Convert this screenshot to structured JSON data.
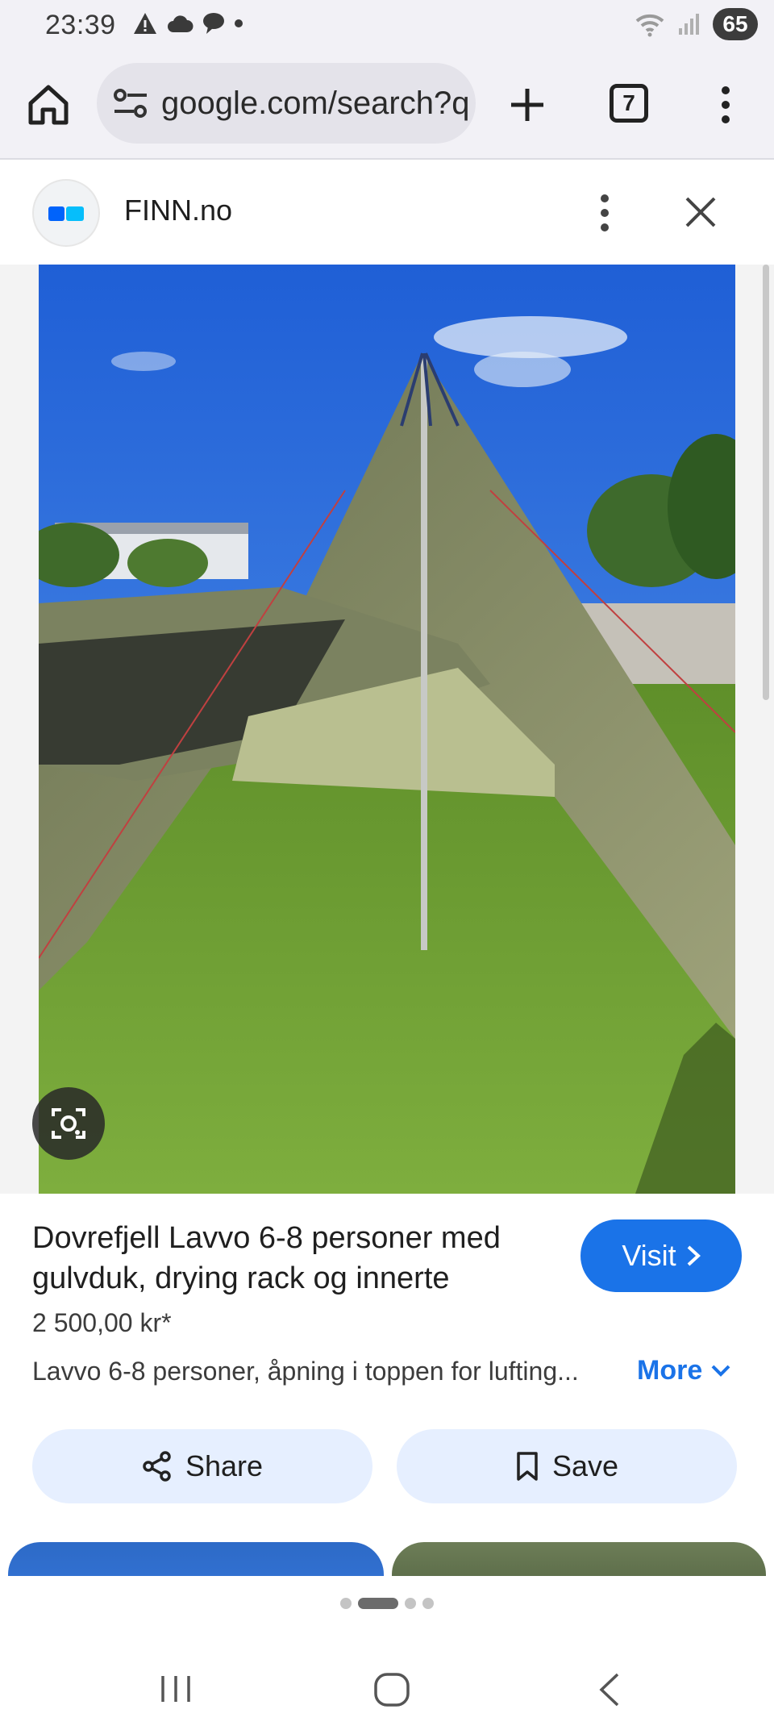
{
  "status_bar": {
    "time": "23:39",
    "battery": "65",
    "left_icons": [
      "warning-icon",
      "cloud-icon",
      "chat-icon",
      "dot-icon"
    ],
    "right_icons": [
      "wifi-icon",
      "signal-icon"
    ]
  },
  "browser": {
    "url": "google.com/search?q",
    "tab_count": "7",
    "icons": [
      "home-icon",
      "site-settings-icon",
      "new-tab-icon",
      "tabs-icon",
      "more-vert-icon"
    ]
  },
  "source": {
    "name": "FINN.no",
    "icons": [
      "finn-logo",
      "more-vert-icon",
      "close-icon"
    ]
  },
  "image": {
    "description_icon": "lens-icon"
  },
  "listing": {
    "title": "Dovrefjell Lavvo 6-8 personer med gulvduk, drying rack og innerte",
    "visit_label": "Visit",
    "price": "2 500,00 kr*",
    "description": "Lavvo 6-8 personer, åpning i toppen for lufting...",
    "more_label": "More",
    "share_label": "Share",
    "save_label": "Save"
  },
  "carousel": {
    "active_index": 1,
    "dot_count": 4
  },
  "nav": {
    "icons": [
      "recent-apps-icon",
      "home-circle-icon",
      "back-icon"
    ]
  },
  "colors": {
    "accent": "#1a73e8",
    "chip_bg": "#e6efff",
    "toolbar_bg": "#f2f1f6"
  }
}
